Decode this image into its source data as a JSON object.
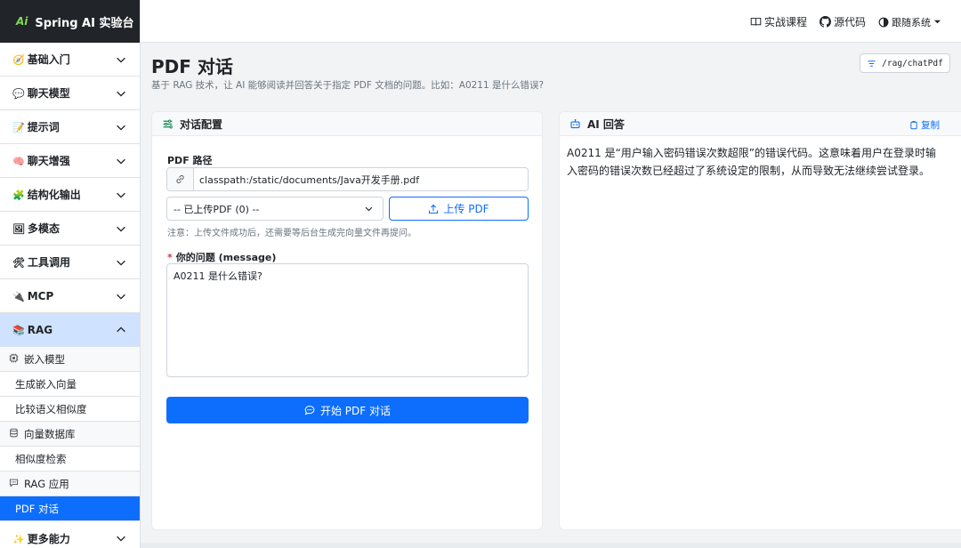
{
  "brand": {
    "logo": "Ai",
    "title": "Spring AI 实验台"
  },
  "topbar": {
    "course": "实战课程",
    "source": "源代码",
    "theme": "跟随系统"
  },
  "sidebar": {
    "categories": [
      {
        "emoji": "🧭",
        "label": "基础入门"
      },
      {
        "emoji": "💬",
        "label": "聊天模型"
      },
      {
        "emoji": "📝",
        "label": "提示词"
      },
      {
        "emoji": "🧠",
        "label": "聊天增强"
      },
      {
        "emoji": "🧩",
        "label": "结构化输出"
      },
      {
        "emoji": "🖼",
        "label": "多模态"
      },
      {
        "emoji": "🛠",
        "label": "工具调用"
      },
      {
        "emoji": "🔌",
        "label": "MCP"
      },
      {
        "emoji": "📚",
        "label": "RAG"
      }
    ],
    "rag_groups": [
      {
        "label": "嵌入模型",
        "items": [
          "生成嵌入向量",
          "比较语义相似度"
        ]
      },
      {
        "label": "向量数据库",
        "items": [
          "相似度检索"
        ]
      },
      {
        "label": "RAG 应用",
        "items": [
          "PDF 对话"
        ]
      }
    ],
    "more": {
      "emoji": "✨",
      "label": "更多能力"
    }
  },
  "page": {
    "title": "PDF 对话",
    "description": "基于 RAG 技术，让 AI 能够阅读并回答关于指定 PDF 文档的问题。比如：A0211 是什么错误?",
    "api_path": "/rag/chatPdf"
  },
  "config": {
    "header": "对话配置",
    "pdf_path_label": "PDF 路径",
    "pdf_path_value": "classpath:/static/documents/Java开发手册.pdf",
    "select_value": "-- 已上传PDF (0) --",
    "upload_label": "上传 PDF",
    "note": "注意：上传文件成功后，还需要等后台生成完向量文件再提问。",
    "question_label": "你的问题 (message)",
    "question_value": "A0211 是什么错误?",
    "submit_label": "开始 PDF 对话"
  },
  "answer": {
    "header": "AI 回答",
    "copy_label": "复制",
    "text": "A0211 是“用户输入密码错误次数超限”的错误代码。这意味着用户在登录时输入密码的错误次数已经超过了系统设定的限制，从而导致无法继续尝试登录。"
  },
  "colors": {
    "primary": "#0d6efd",
    "dark": "#212529",
    "active_bg": "#cfe2ff"
  }
}
